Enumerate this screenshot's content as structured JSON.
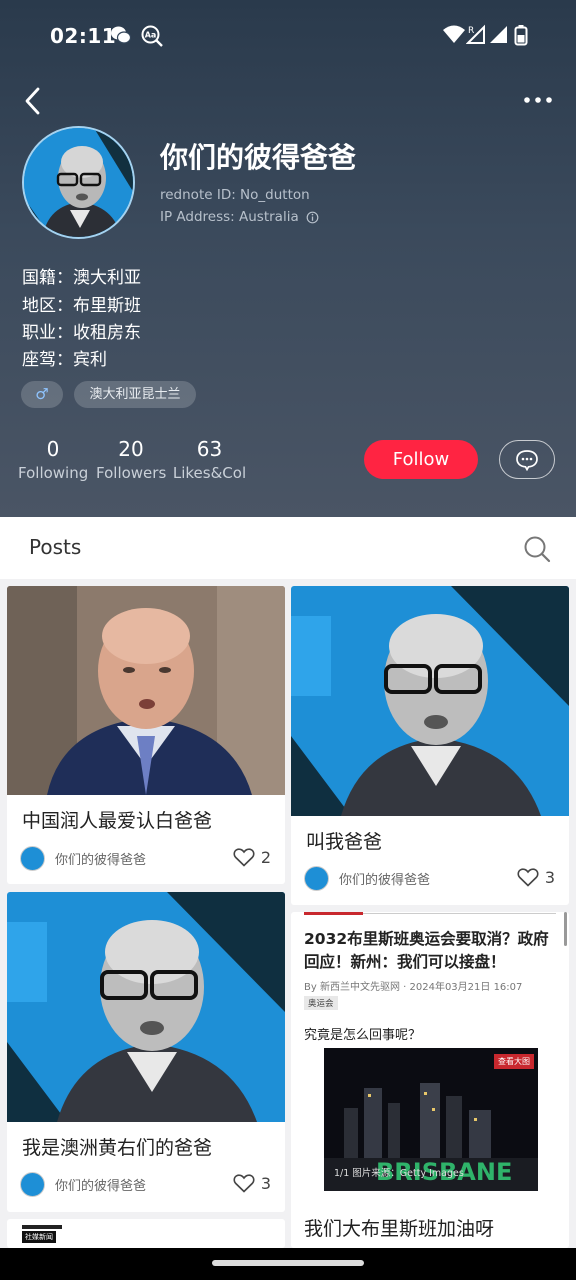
{
  "status_bar": {
    "time": "02:11"
  },
  "profile": {
    "nickname": "你们的彼得爸爸",
    "rednote_id": "rednote ID: No_dutton",
    "ip_address": "IP Address: Australia",
    "info": [
      {
        "label": "国籍：",
        "value": "澳大利亚"
      },
      {
        "label": "地区：",
        "value": "布里斯班"
      },
      {
        "label": "职业：",
        "value": "收租房东"
      },
      {
        "label": "座驾：",
        "value": "宾利"
      }
    ],
    "gender_symbol": "♂",
    "location_tag": "澳大利亚昆士兰",
    "stats": [
      {
        "value": "0",
        "label": "Following"
      },
      {
        "value": "20",
        "label": "Followers"
      },
      {
        "value": "63",
        "label": "Likes&Col"
      }
    ],
    "follow_label": "Follow"
  },
  "posts_bar": {
    "title": "Posts"
  },
  "cards": [
    {
      "title": "中国润人最爱认白爸爸",
      "author": "你们的彼得爸爸",
      "likes": "2"
    },
    {
      "title": "叫我爸爸",
      "author": "你们的彼得爸爸",
      "likes": "3"
    },
    {
      "title": "我是澳洲黄右们的爸爸",
      "author": "你们的彼得爸爸",
      "likes": "3"
    }
  ],
  "news_card": {
    "headline": "2032布里斯班奥运会要取消？政府回应！新州：我们可以接盘！",
    "source": "By 新西兰中文先驱网 · 2024年03月21日 16:07",
    "tag": "奥运会",
    "question": "究竟是怎么回事呢？",
    "photo_tag": "查看大图",
    "photo_caption": "1/1    图片来源：Getty Images",
    "title": "我们大布里斯班加油呀"
  },
  "partial_card_tag": "社媒新闻",
  "colors": {
    "accent": "#ff2442",
    "header_bg": "#34465a",
    "blue_bg": "#1e8fd6"
  }
}
